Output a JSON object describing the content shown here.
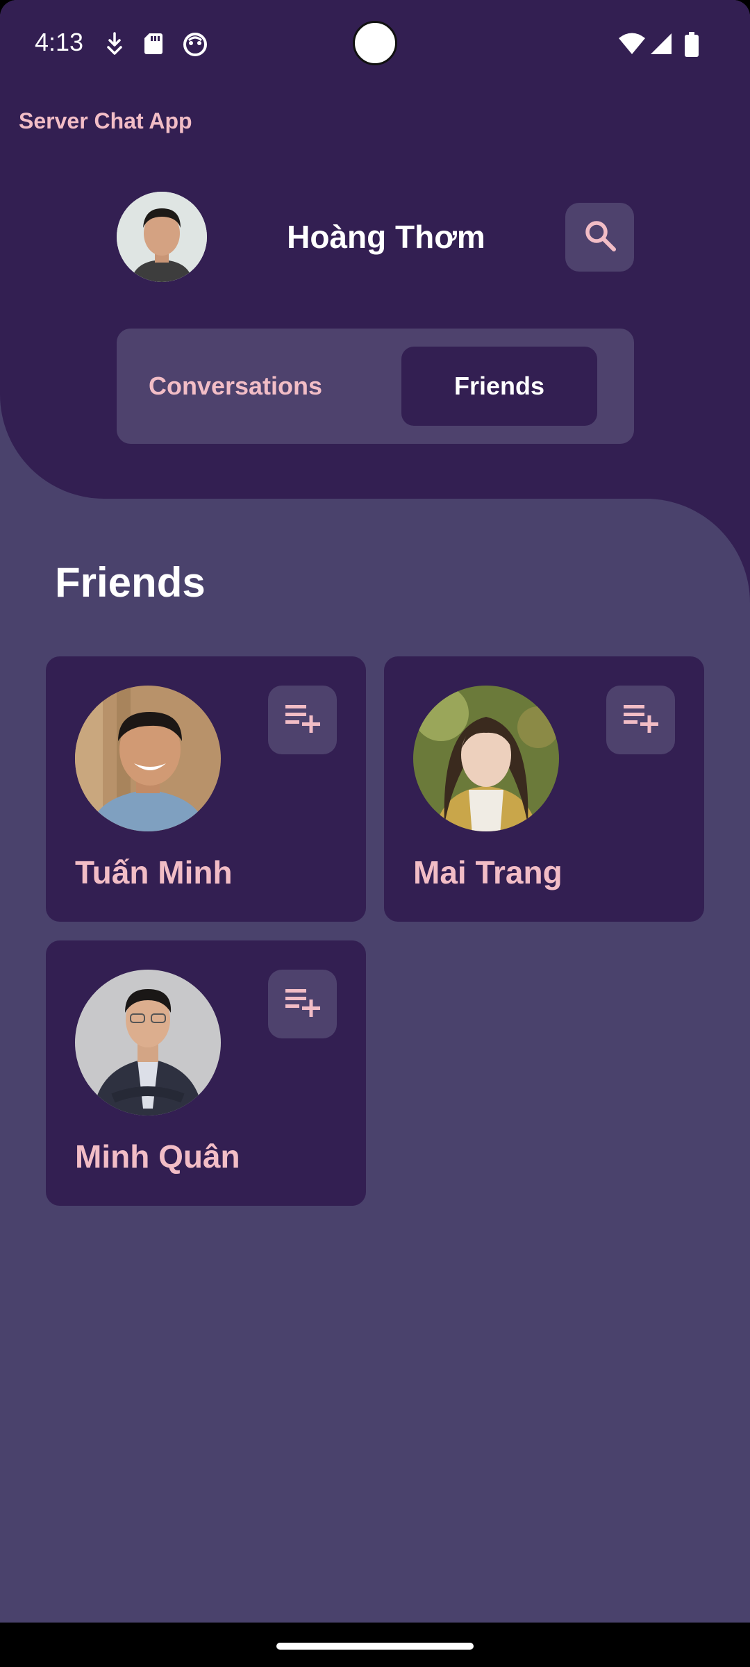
{
  "status_bar": {
    "time": "4:13",
    "left_icons": [
      "download-icon",
      "sd-card-icon",
      "app-face-icon"
    ],
    "right_icons": [
      "wifi-icon",
      "signal-icon",
      "battery-icon"
    ]
  },
  "app": {
    "title": "Server Chat App"
  },
  "profile": {
    "name": "Hoàng Thơm",
    "avatar_icon": "user-avatar"
  },
  "search": {
    "icon": "search-icon"
  },
  "tabs": [
    {
      "label": "Conversations",
      "selected": false
    },
    {
      "label": "Friends",
      "selected": true
    }
  ],
  "section": {
    "title": "Friends"
  },
  "friends": [
    {
      "name": "Tuấn Minh",
      "action_icon": "playlist-add-icon"
    },
    {
      "name": "Mai Trang",
      "action_icon": "playlist-add-icon"
    },
    {
      "name": "Minh Quân",
      "action_icon": "playlist-add-icon"
    }
  ],
  "colors": {
    "header_bg": "#331f52",
    "content_bg": "#4a426c",
    "accent_pink": "#f2bdc6",
    "button_bg": "#4e426d"
  }
}
